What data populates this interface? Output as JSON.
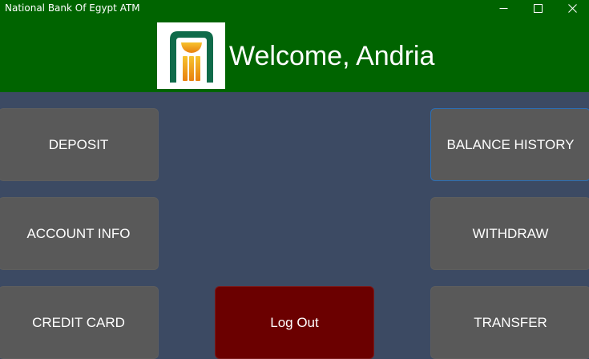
{
  "window": {
    "title": "National Bank Of Egypt ATM",
    "controls": [
      "minimize-icon",
      "maximize-icon",
      "close-icon"
    ]
  },
  "header": {
    "background": "#006400",
    "logo_icon": "nbe-logo-icon",
    "welcome_text": "Welcome, Andria"
  },
  "buttons": {
    "deposit": "DEPOSIT",
    "account_info": "ACCOUNT INFO",
    "credit_card": "CREDIT CARD",
    "balance_history": "BALANCE HISTORY",
    "withdraw": "WITHDRAW",
    "transfer": "TRANSFER",
    "logout": "Log Out"
  },
  "colors": {
    "panel_background": "#3c4a63",
    "button_background": "#595959",
    "logout_background": "#6b0000",
    "focus_border": "#2c6fb5"
  }
}
